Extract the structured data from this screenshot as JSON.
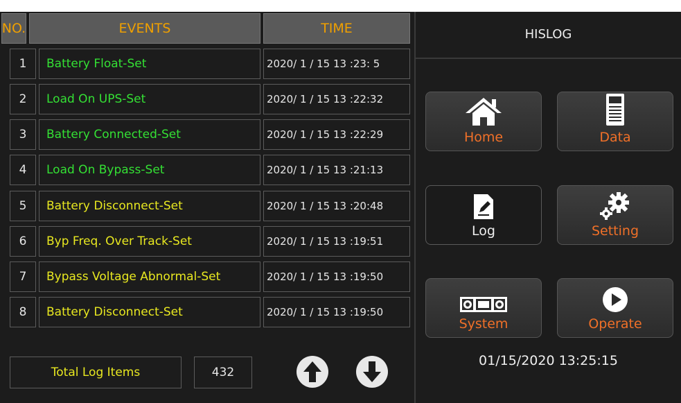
{
  "header": {
    "no": "NO.",
    "events": "EVENTS",
    "time": "TIME"
  },
  "rows": [
    {
      "no": "1",
      "event": "Battery Float-Set",
      "time": "2020/ 1 / 15   13 :23: 5",
      "color": "green"
    },
    {
      "no": "2",
      "event": "Load On UPS-Set",
      "time": "2020/ 1 / 15   13 :22:32",
      "color": "green"
    },
    {
      "no": "3",
      "event": "Battery Connected-Set",
      "time": "2020/ 1 / 15   13 :22:29",
      "color": "green"
    },
    {
      "no": "4",
      "event": "Load On Bypass-Set",
      "time": "2020/ 1 / 15   13 :21:13",
      "color": "green"
    },
    {
      "no": "5",
      "event": "Battery Disconnect-Set",
      "time": "2020/ 1 / 15   13 :20:48",
      "color": "yellow"
    },
    {
      "no": "6",
      "event": "Byp Freq. Over Track-Set",
      "time": "2020/ 1 / 15   13 :19:51",
      "color": "yellow"
    },
    {
      "no": "7",
      "event": "Bypass Voltage Abnormal-Set",
      "time": "2020/ 1 / 15   13 :19:50",
      "color": "yellow"
    },
    {
      "no": "8",
      "event": "Battery Disconnect-Set",
      "time": "2020/ 1 / 15   13 :19:50",
      "color": "yellow"
    }
  ],
  "footer": {
    "total_label": "Total Log Items",
    "total_value": "432"
  },
  "panel": {
    "title": "HISLOG",
    "buttons": [
      {
        "label": "Home",
        "icon": "home-icon"
      },
      {
        "label": "Data",
        "icon": "data-icon"
      },
      {
        "label": "Log",
        "icon": "log-icon"
      },
      {
        "label": "Setting",
        "icon": "gear-icon"
      },
      {
        "label": "System",
        "icon": "system-icon"
      },
      {
        "label": "Operate",
        "icon": "play-icon"
      }
    ],
    "datetime": "01/15/2020  13:25:15"
  },
  "colors": {
    "header_text": "#f0a000",
    "green_event": "#34e034",
    "yellow_event": "#e8e820",
    "nav_label": "#f07028",
    "background": "#1c1c1c"
  }
}
